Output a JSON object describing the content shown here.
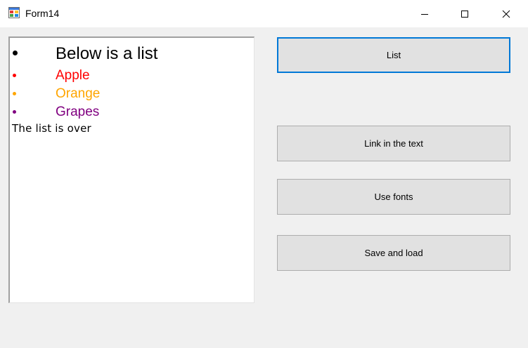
{
  "window": {
    "title": "Form14"
  },
  "richtext": {
    "heading": {
      "text": "Below is a list",
      "color": "#000000"
    },
    "items": [
      {
        "text": "Apple",
        "color": "#ff0000"
      },
      {
        "text": "Orange",
        "color": "#ffa500"
      },
      {
        "text": "Grapes",
        "color": "#800080"
      }
    ],
    "footer": "The list is over"
  },
  "buttons": {
    "list": "List",
    "link_in_text": "Link in the text",
    "use_fonts": "Use fonts",
    "save_and_load": "Save and load"
  },
  "colors": {
    "focus_border": "#0078d7",
    "button_face": "#e1e1e1",
    "form_background": "#f0f0f0"
  }
}
